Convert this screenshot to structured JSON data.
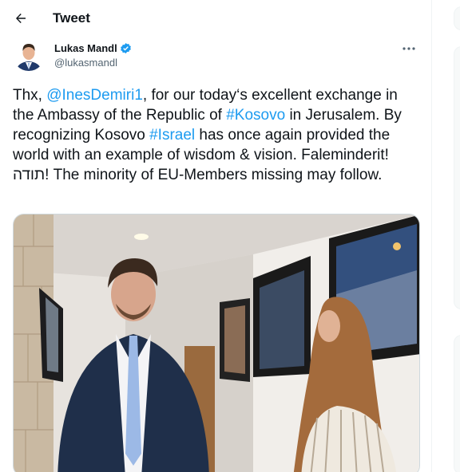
{
  "header": {
    "title": "Tweet",
    "back_icon": "arrow-left-icon"
  },
  "author": {
    "name": "Lukas Mandl",
    "handle": "@lukasmandl",
    "verified": true,
    "verified_color": "#1d9bf0",
    "more_icon": "more-horizontal-icon"
  },
  "tweet": {
    "seg1": "Thx, ",
    "mention": "@InesDemiri1",
    "seg2": ", for our today‘s excellent exchange in the Ambassy of the Republic of ",
    "hashtag1": "#Kosovo",
    "seg3": " in Jerusalem. By recognizing Kosovo ",
    "hashtag2": "#Israel",
    "seg4": " has once again provided the world with an example of wisdom & vision. Faleminderit! תודה! The minority of EU-Members missing may follow."
  },
  "colors": {
    "link": "#1d9bf0",
    "text": "#0f1419",
    "secondary": "#536471"
  }
}
